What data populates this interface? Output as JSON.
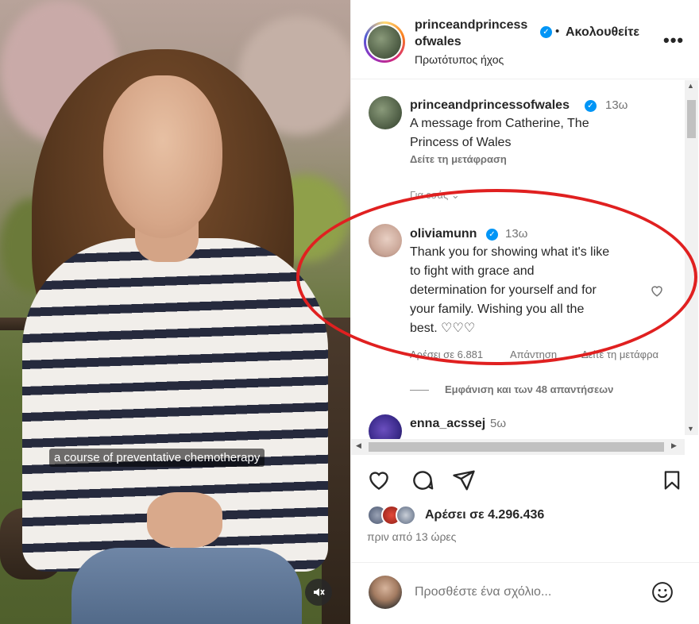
{
  "video": {
    "caption": "a course of preventative chemotherapy",
    "mute_icon": "speaker-muted-icon"
  },
  "header": {
    "username_line1": "princeandprincess",
    "username_line2": "ofwales",
    "dot": "•",
    "follow": "Ακολουθείτε",
    "audio": "Πρωτότυπος ήχος",
    "more": "•••"
  },
  "comments": [
    {
      "username": "princeandprincessofwales",
      "time": "13ω",
      "text_lines": [
        "A message from Catherine, The",
        "Princess of Wales"
      ],
      "translate": "Δείτε τη μετάφραση",
      "hidden_hint": "Για εσάς ⌄"
    },
    {
      "username": "oliviamunn",
      "time": "13ω",
      "text_lines": [
        "Thank you for showing what it's like",
        "to fight with grace and",
        "determination for yourself and for",
        "your family. Wishing you all the",
        "best. ♡♡♡"
      ],
      "likes": "Αρέσει σε 6.881",
      "reply": "Απάντηση",
      "translate": "Δείτε τη μετάφρα"
    },
    {
      "username": "enna_acssej",
      "time": "5ω"
    }
  ],
  "view_replies": "Εμφάνιση και των 48 απαντήσεων",
  "actions": {
    "like_icon": "heart-icon",
    "comment_icon": "comment-icon",
    "share_icon": "paper-plane-icon",
    "save_icon": "bookmark-icon"
  },
  "likes_summary": "Αρέσει σε 4.296.436",
  "time_ago": "πριν από 13 ώρες",
  "add_comment": {
    "placeholder": "Προσθέστε ένα σχόλιο..."
  },
  "colors": {
    "verified": "#0095f6",
    "annotation": "#e02020"
  }
}
